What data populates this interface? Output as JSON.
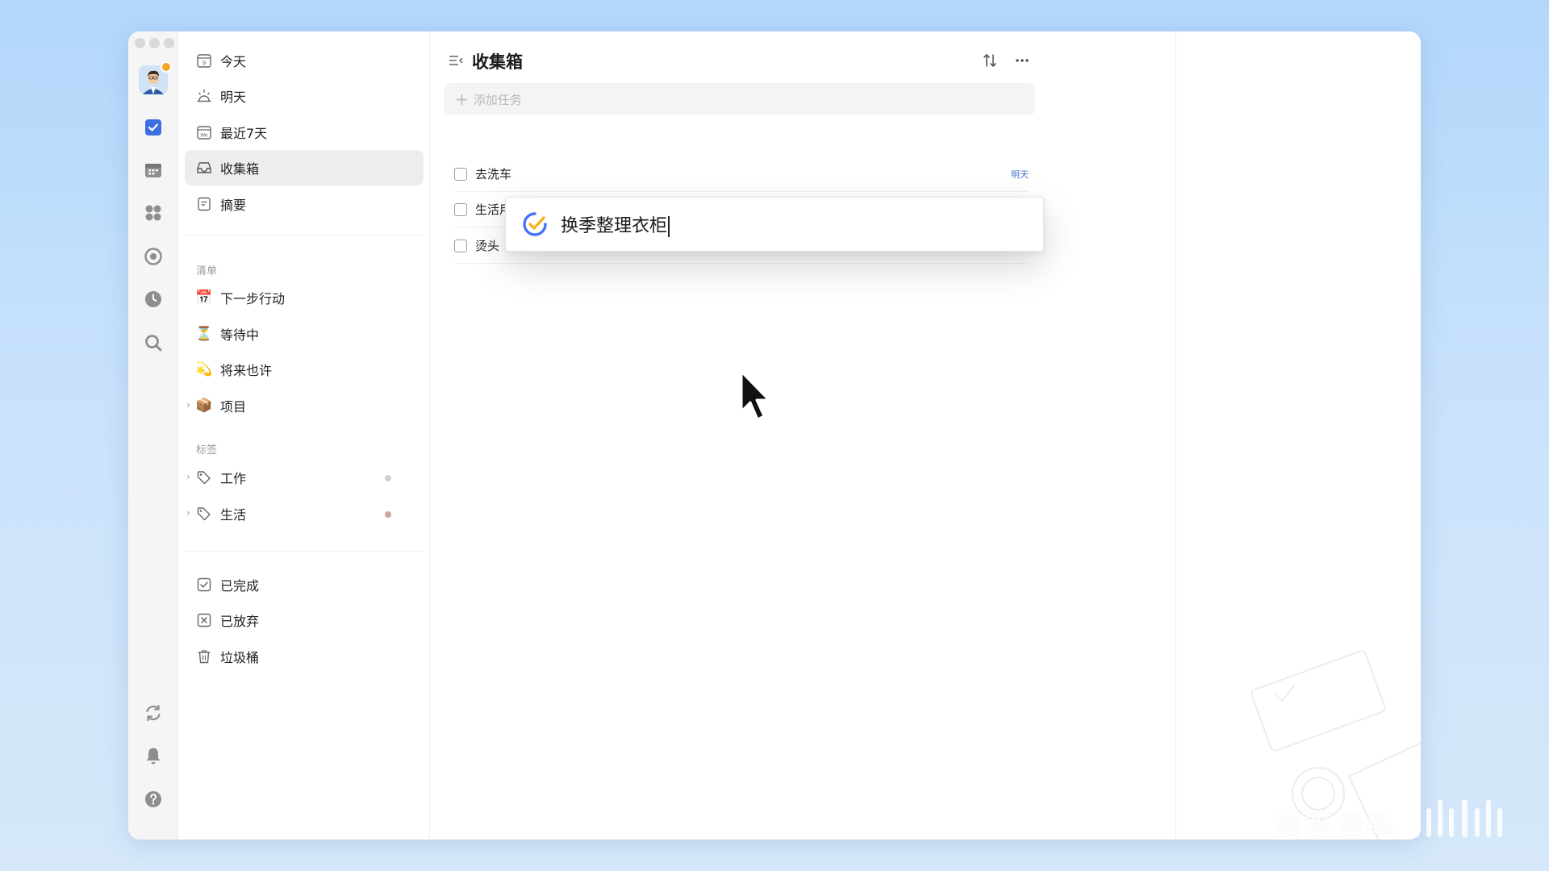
{
  "window": {
    "title": "收集箱"
  },
  "rail": {
    "items": [
      {
        "icon": "checkbox-icon",
        "active": true
      },
      {
        "icon": "calendar-icon",
        "active": false
      },
      {
        "icon": "grid-icon",
        "active": false
      },
      {
        "icon": "target-icon",
        "active": false
      },
      {
        "icon": "clock-icon",
        "active": false
      },
      {
        "icon": "search-icon",
        "active": false
      }
    ],
    "bottom": [
      {
        "icon": "sync-icon"
      },
      {
        "icon": "bell-icon"
      },
      {
        "icon": "help-icon"
      }
    ],
    "accent": "#3b6fe0"
  },
  "sidebar": {
    "smart_lists": [
      {
        "label": "今天",
        "icon": "calendar-day-icon"
      },
      {
        "label": "明天",
        "icon": "sunrise-icon"
      },
      {
        "label": "最近7天",
        "icon": "week-icon"
      },
      {
        "label": "收集箱",
        "icon": "inbox-icon",
        "active": true
      },
      {
        "label": "摘要",
        "icon": "summary-icon"
      }
    ],
    "lists_section_label": "清单",
    "lists": [
      {
        "label": "下一步行动",
        "emoji": "📅"
      },
      {
        "label": "等待中",
        "emoji": "⏳"
      },
      {
        "label": "将来也许",
        "emoji": "💫"
      },
      {
        "label": "项目",
        "emoji": "📦"
      }
    ],
    "tags_section_label": "标签",
    "tags": [
      {
        "label": "工作",
        "dot_color": "#cfcfcf"
      },
      {
        "label": "生活",
        "dot_color": "#c9a79c"
      }
    ],
    "system": [
      {
        "label": "已完成",
        "icon": "check-square-icon"
      },
      {
        "label": "已放弃",
        "icon": "x-square-icon"
      },
      {
        "label": "垃圾桶",
        "icon": "trash-icon"
      }
    ]
  },
  "main": {
    "title": "收集箱",
    "add_task_placeholder": "添加任务",
    "tasks": [
      {
        "name": "去洗车",
        "due": "明天"
      },
      {
        "name": "生活用品清点",
        "due": ""
      },
      {
        "name": "烫头",
        "due": ""
      }
    ]
  },
  "quick_add": {
    "text": "换季整理衣柜"
  },
  "watermark": {
    "text": "滴答清单"
  }
}
